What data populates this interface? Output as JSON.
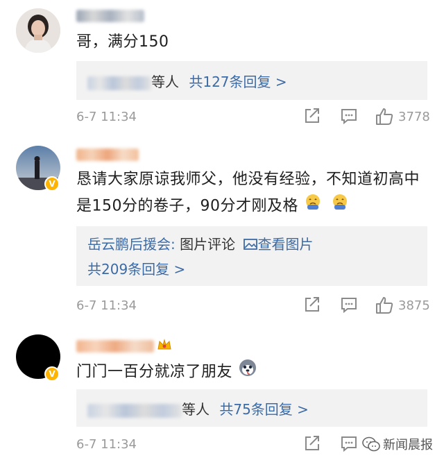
{
  "comments": [
    {
      "text": "哥，满分150",
      "reply_suffix": "等人",
      "reply_link": "共127条回复 >",
      "time": "6-7 11:34",
      "likes": "3778"
    },
    {
      "text": "恳请大家原谅我师父，他没有经验，不知道初高中是150分的卷子，90分才刚及格",
      "reply_line1_author": "岳云鹏后援会:",
      "reply_line1_text": "图片评论",
      "reply_line1_link": "查看图片",
      "reply_link": "共209条回复 >",
      "time": "6-7 11:34",
      "likes": "3875"
    },
    {
      "text": "门门一百分就凉了朋友",
      "reply_suffix": "等人",
      "reply_link": "共75条回复 >",
      "time": "6-7 11:34"
    }
  ],
  "watermark": "新闻晨报",
  "colors": {
    "link": "#3c6aa5",
    "meta": "#9a9a9a",
    "reply_bg": "#f2f2f2",
    "badge": "#ffb400"
  }
}
